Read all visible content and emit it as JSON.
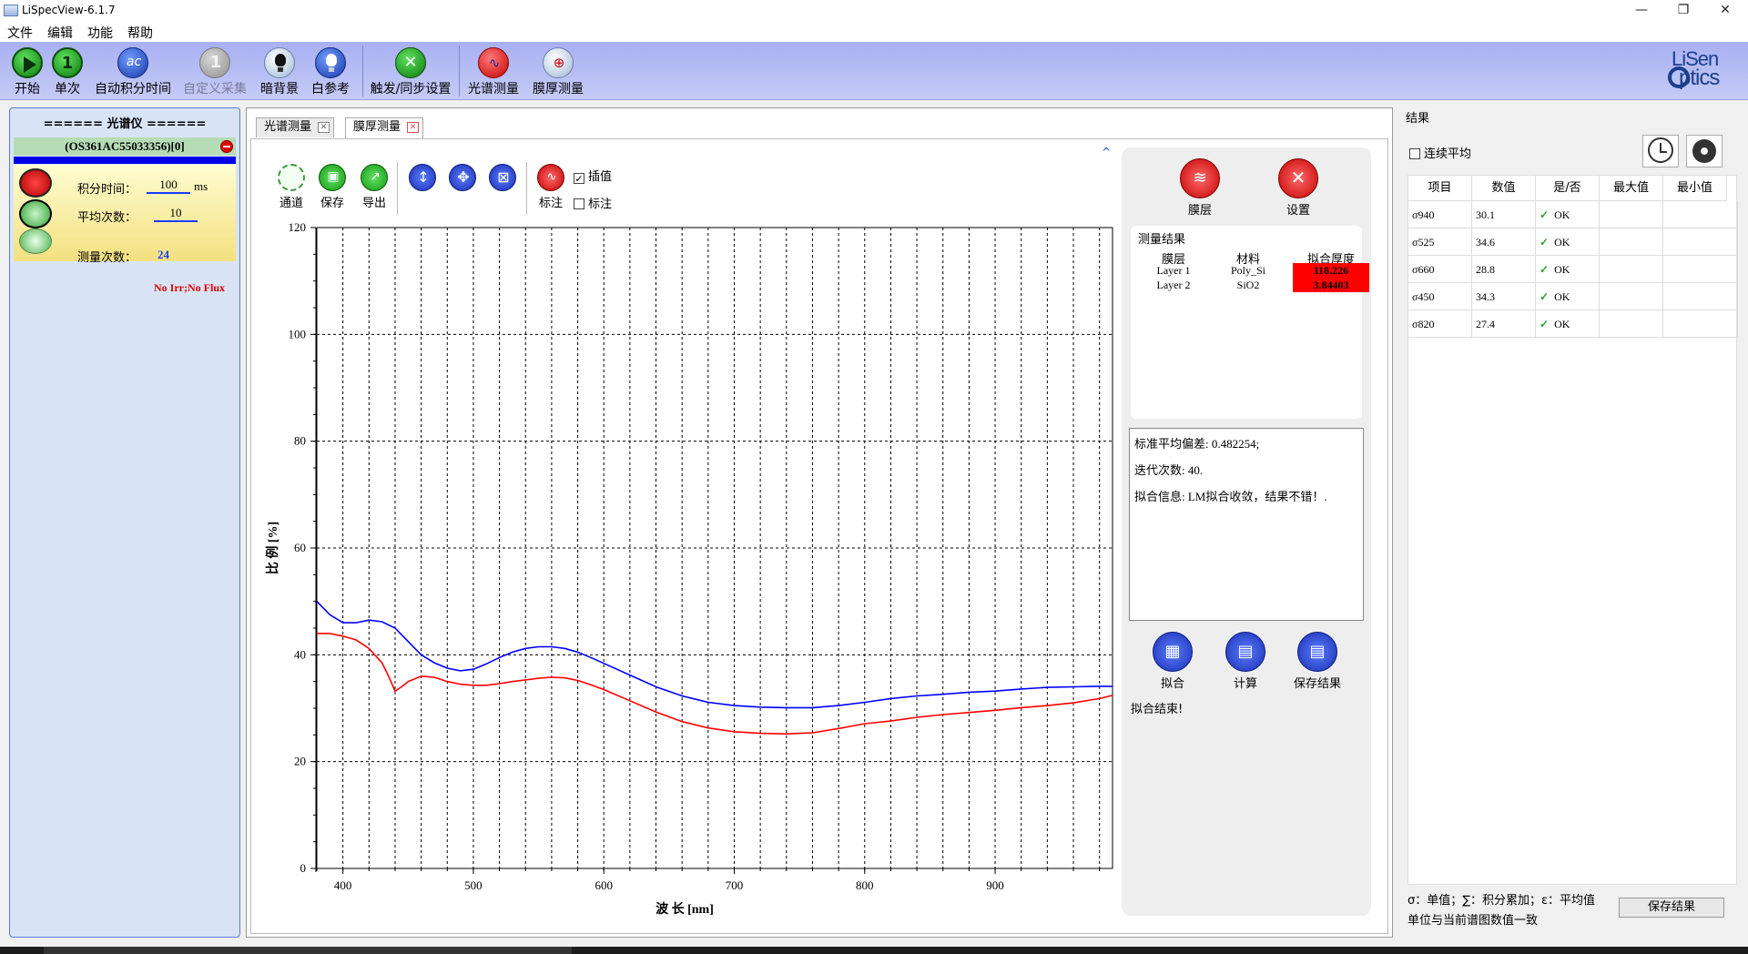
{
  "window": {
    "title": "LiSpecView-6.1.7",
    "minimize": "—",
    "maximize": "❐",
    "close": "✕"
  },
  "menu": [
    "文件",
    "编辑",
    "功能",
    "帮助"
  ],
  "toolbar": {
    "start": "开始",
    "single": "单次",
    "single_badge": "1",
    "auto_integration": "自动积分时间",
    "auto_integration_badge": "ac",
    "custom_collect": "自定义采集",
    "custom_collect_badge": "1",
    "dark_background": "暗背景",
    "white_reference": "白参考",
    "trigger_sync": "触发/同步设置",
    "spectrum_measure": "光谱测量",
    "film_measure": "膜厚测量"
  },
  "logo": {
    "line1": "LiSen",
    "line2": "ptics"
  },
  "spectrometer": {
    "title": "====== 光谱仪 ======",
    "device": "(OS361AC55033356)[0]",
    "integration_label": "积分时间：",
    "integration_value": "100",
    "integration_unit": "ms",
    "average_label": "平均次数：",
    "average_value": "10",
    "status": "No Irr;No Flux",
    "count_label": "测量次数：",
    "count_value": "24"
  },
  "tabs": [
    {
      "label": "光谱测量",
      "active": false
    },
    {
      "label": "膜厚测量",
      "active": true
    }
  ],
  "chart_tools": {
    "channel": "通道",
    "save": "保存",
    "export": "导出",
    "annotate": "标注",
    "interpolate_label": "插值",
    "interpolate_checked": true,
    "annotate_check_label": "标注",
    "annotate_checked": false
  },
  "film_panel": {
    "layers_button": "膜层",
    "settings_button": "设置",
    "results_title": "测量结果",
    "headers": [
      "膜层",
      "材料",
      "拟合厚度"
    ],
    "rows": [
      {
        "layer": "Layer 1",
        "material": "Poly_Si",
        "thickness": "118.226"
      },
      {
        "layer": "Layer 2",
        "material": "SiO2",
        "thickness": "3.84403"
      }
    ],
    "info_std": "标准平均偏差: 0.482254;",
    "info_iter": "迭代次数: 40.",
    "info_msg": "拟合信息: LM拟合收敛，结果不错！.",
    "fit_button": "拟合",
    "calc_button": "计算",
    "save_button": "保存结果",
    "status": "拟合结束!"
  },
  "results_panel": {
    "title": "结果",
    "continuous_label": "连续平均",
    "headers": [
      "项目",
      "数值",
      "是/否",
      "最大值",
      "最小值"
    ],
    "rows": [
      {
        "item": "σ940",
        "value": "30.1",
        "ok": "OK"
      },
      {
        "item": "σ525",
        "value": "34.6",
        "ok": "OK"
      },
      {
        "item": "σ660",
        "value": "28.8",
        "ok": "OK"
      },
      {
        "item": "σ450",
        "value": "34.3",
        "ok": "OK"
      },
      {
        "item": "σ820",
        "value": "27.4",
        "ok": "OK"
      }
    ],
    "legend_note": "σ：单值；∑：积分累加；ε：平均值",
    "unit_note": "单位与当前谱图数值一致",
    "save_button": "保存结果"
  },
  "chart_data": {
    "type": "line",
    "xlabel": "波 长 [nm]",
    "ylabel": "比 例 [%]",
    "xlim": [
      380,
      990
    ],
    "ylim": [
      0,
      120
    ],
    "xticks": [
      400,
      500,
      600,
      700,
      800,
      900
    ],
    "yticks": [
      0,
      20,
      40,
      60,
      80,
      100,
      120
    ],
    "grid": true,
    "series": [
      {
        "color": "#0000ff",
        "x": [
          380,
          390,
          400,
          410,
          420,
          430,
          440,
          450,
          460,
          470,
          480,
          490,
          500,
          510,
          520,
          530,
          540,
          550,
          560,
          570,
          580,
          590,
          600,
          620,
          640,
          660,
          680,
          700,
          720,
          740,
          760,
          780,
          800,
          820,
          840,
          860,
          880,
          900,
          920,
          940,
          960,
          980,
          990
        ],
        "y": [
          50,
          47.5,
          46,
          46,
          46.5,
          46.2,
          45,
          42.5,
          40,
          38.5,
          37.5,
          37,
          37.3,
          38.3,
          39.5,
          40.5,
          41.2,
          41.5,
          41.5,
          41.2,
          40.5,
          39.5,
          38.4,
          36.2,
          34,
          32.3,
          31.1,
          30.5,
          30.2,
          30.1,
          30.1,
          30.5,
          31.1,
          31.8,
          32.3,
          32.6,
          33,
          33.2,
          33.6,
          33.9,
          34,
          34.1,
          34.1
        ]
      },
      {
        "color": "#ff0000",
        "x": [
          380,
          390,
          400,
          410,
          420,
          430,
          435,
          440,
          445,
          450,
          460,
          470,
          480,
          490,
          500,
          510,
          520,
          530,
          540,
          550,
          560,
          570,
          580,
          590,
          600,
          620,
          640,
          660,
          680,
          700,
          720,
          740,
          760,
          780,
          800,
          820,
          840,
          860,
          880,
          900,
          920,
          940,
          960,
          980,
          990
        ],
        "y": [
          44,
          44,
          43.5,
          42.8,
          41.2,
          38.5,
          36,
          33.2,
          34,
          35,
          36,
          35.8,
          35,
          34.5,
          34.3,
          34.3,
          34.6,
          35,
          35.3,
          35.6,
          35.8,
          35.7,
          35.2,
          34.4,
          33.5,
          31.4,
          29.3,
          27.5,
          26.3,
          25.6,
          25.3,
          25.2,
          25.4,
          26.2,
          27.1,
          27.6,
          28.3,
          28.8,
          29.2,
          29.6,
          30.1,
          30.5,
          31,
          31.8,
          32.4
        ]
      }
    ]
  }
}
